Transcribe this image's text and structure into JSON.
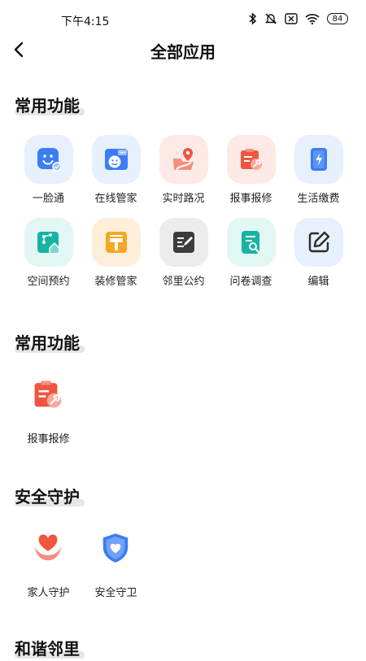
{
  "status_bar": {
    "time": "下午4:15",
    "battery": "84"
  },
  "header": {
    "title": "全部应用"
  },
  "sections": [
    {
      "title": "常用功能",
      "items": [
        {
          "label": "一脸通",
          "icon": "face-id-icon"
        },
        {
          "label": "在线管家",
          "icon": "online-butler-icon"
        },
        {
          "label": "实时路况",
          "icon": "traffic-map-icon"
        },
        {
          "label": "报事报修",
          "icon": "repair-report-icon"
        },
        {
          "label": "生活缴费",
          "icon": "bill-payment-icon"
        },
        {
          "label": "空间预约",
          "icon": "space-booking-icon"
        },
        {
          "label": "装修管家",
          "icon": "renovation-icon"
        },
        {
          "label": "邻里公约",
          "icon": "neighbor-pact-icon"
        },
        {
          "label": "问卷调查",
          "icon": "survey-icon"
        },
        {
          "label": "编辑",
          "icon": "edit-icon"
        }
      ]
    },
    {
      "title": "常用功能",
      "items": [
        {
          "label": "报事报修",
          "icon": "repair-report-icon"
        }
      ]
    },
    {
      "title": "安全守护",
      "items": [
        {
          "label": "家人守护",
          "icon": "family-guard-icon"
        },
        {
          "label": "安全守卫",
          "icon": "security-shield-icon"
        }
      ]
    },
    {
      "title": "和谐邻里",
      "items": []
    }
  ],
  "colors": {
    "blue": "#3a7df4",
    "red": "#f0553f",
    "teal": "#17b3a3",
    "orange": "#f6a623",
    "dark": "#3c3c3c"
  }
}
